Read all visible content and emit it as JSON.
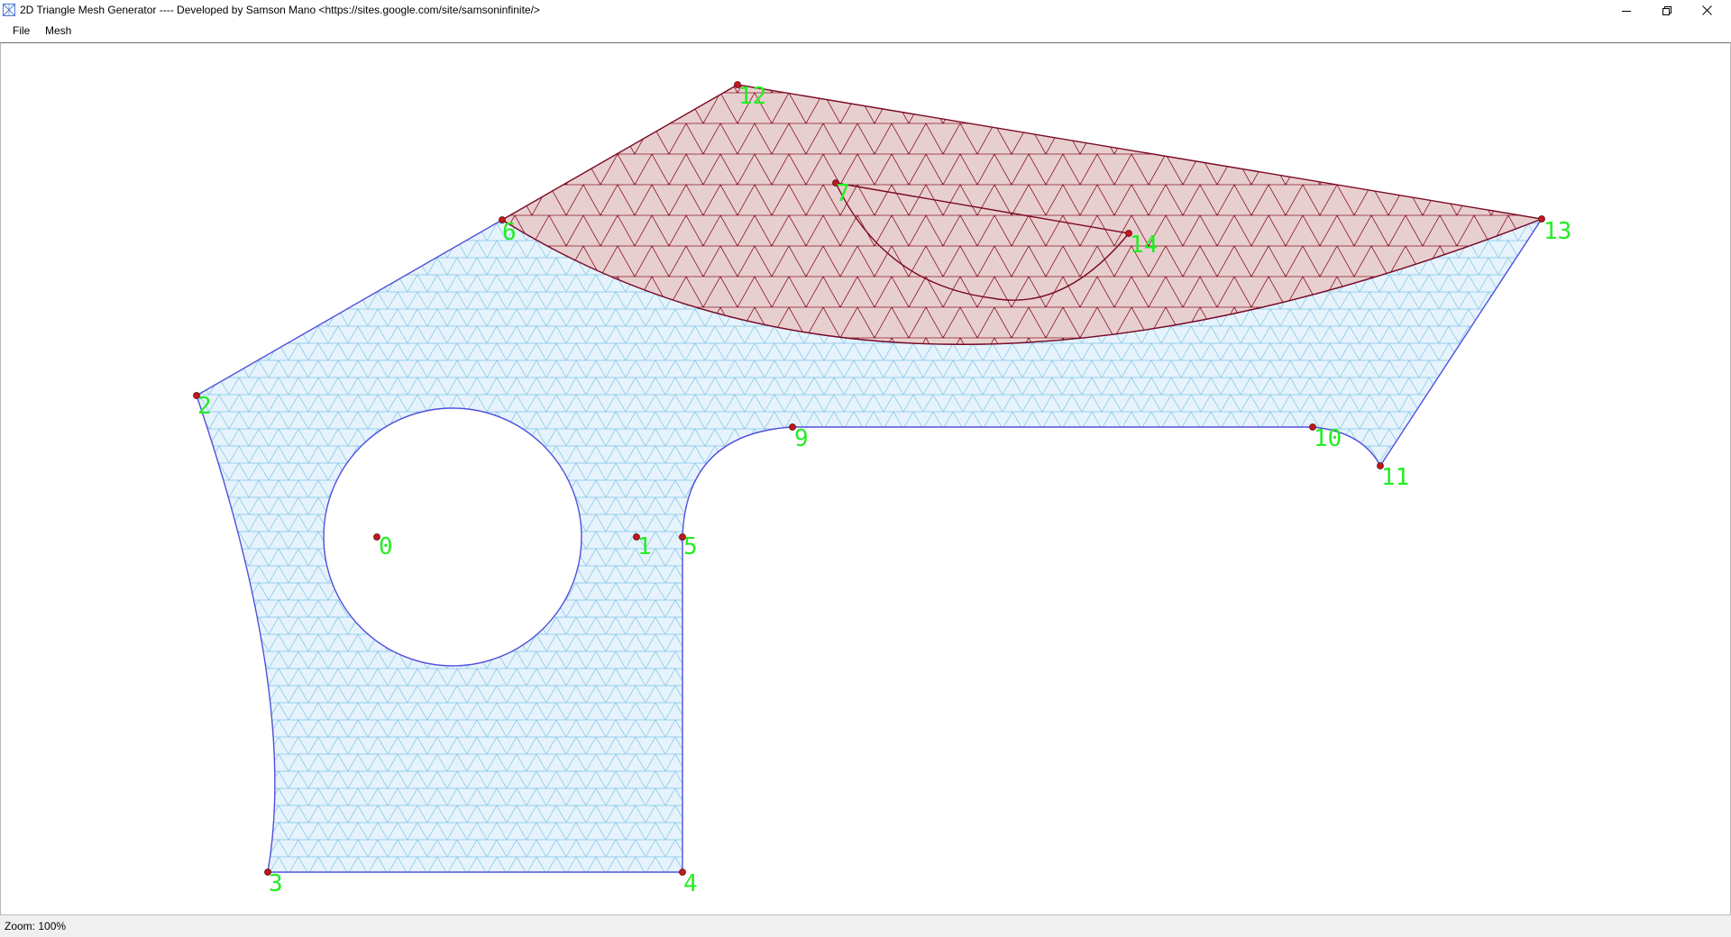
{
  "window": {
    "title": "2D Triangle Mesh Generator ---- Developed by Samson Mano <https://sites.google.com/site/samsoninfinite/>",
    "app_icon": "mesh-app-icon",
    "controls": {
      "minimize_icon": "minimize-icon",
      "restore_icon": "restore-icon",
      "close_icon": "close-icon"
    }
  },
  "menubar": {
    "items": [
      {
        "label": "File"
      },
      {
        "label": "Mesh"
      }
    ]
  },
  "mesh_view": {
    "colors": {
      "blue_fill": "#e6f3fc",
      "blue_edge": "#7ec4e6",
      "blue_boundary": "#5050dc",
      "red_fill": "#e8cfcf",
      "red_edge": "#8a1a2a",
      "red_boundary": "#7a0a24",
      "node_marker": "#c0181c",
      "label": "#22ee22"
    },
    "nodes": [
      {
        "label": "0"
      },
      {
        "label": "1"
      },
      {
        "label": "2"
      },
      {
        "label": "3"
      },
      {
        "label": "4"
      },
      {
        "label": "5"
      },
      {
        "label": "6"
      },
      {
        "label": "7"
      },
      {
        "label": "9"
      },
      {
        "label": "10"
      },
      {
        "label": "11"
      },
      {
        "label": "12"
      },
      {
        "label": "13"
      },
      {
        "label": "14"
      }
    ]
  },
  "statusbar": {
    "zoom_text": "Zoom: 100%"
  }
}
